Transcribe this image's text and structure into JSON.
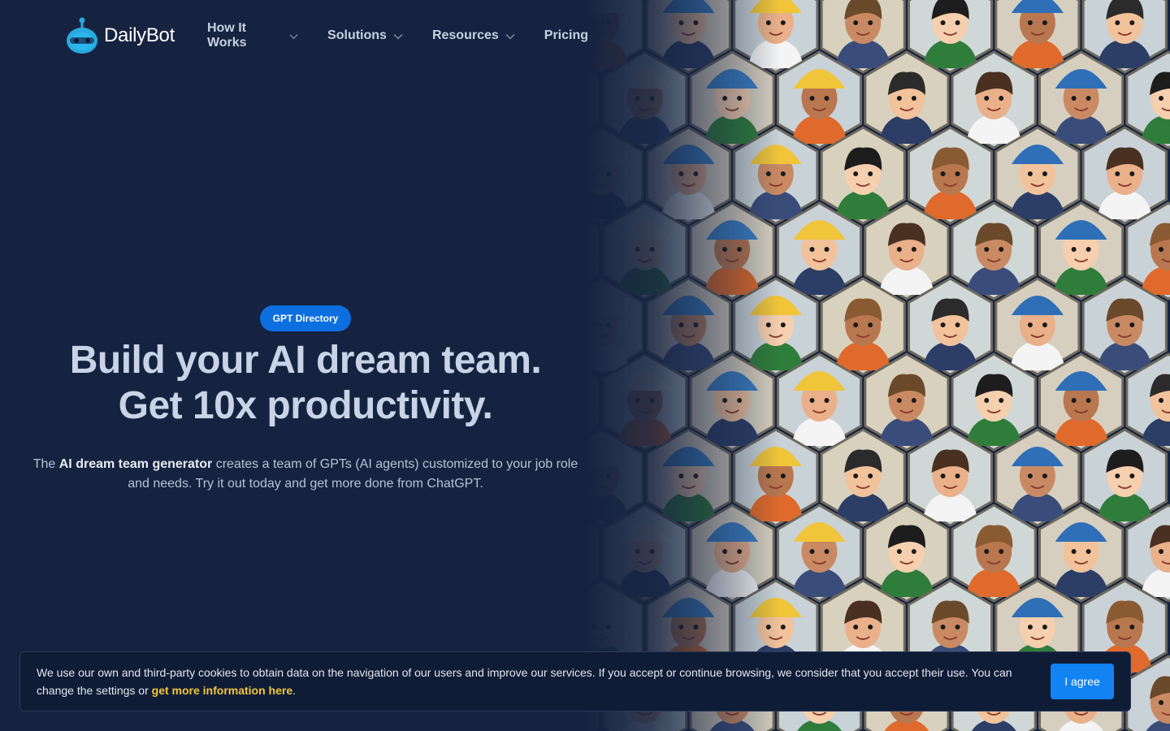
{
  "brand": {
    "name": "DailyBot",
    "logo_icon": "robot-head-icon",
    "logo_color": "#29a9e0"
  },
  "nav": {
    "items": [
      {
        "label": "How It Works",
        "has_dropdown": true
      },
      {
        "label": "Solutions",
        "has_dropdown": true
      },
      {
        "label": "Resources",
        "has_dropdown": true
      },
      {
        "label": "Pricing",
        "has_dropdown": false
      }
    ],
    "dropdown_icon": "chevron-down-icon"
  },
  "hero": {
    "badge": "GPT Directory",
    "headline_line1": "Build your AI dream team.",
    "headline_line2": "Get 10x productivity.",
    "sub_prefix": "The ",
    "sub_bold": "AI dream team generator",
    "sub_rest": " creates a team of GPTs (AI agents) customized to your job role and needs. Try it out today and get more done from ChatGPT.",
    "illustration": "cartoon-professionals-hex-pattern"
  },
  "cookie": {
    "text_part1": "We use our own and third-party cookies to obtain data on the navigation of our users and improve our services. If you accept or continue browsing, we consider that you accept their use. You can change the settings or ",
    "link_text": "get more information here",
    "text_part2": ".",
    "agree_label": "I agree"
  },
  "colors": {
    "background": "#152340",
    "badge": "#0b6fe0",
    "button": "#1283f2",
    "link": "#f3c63e"
  }
}
